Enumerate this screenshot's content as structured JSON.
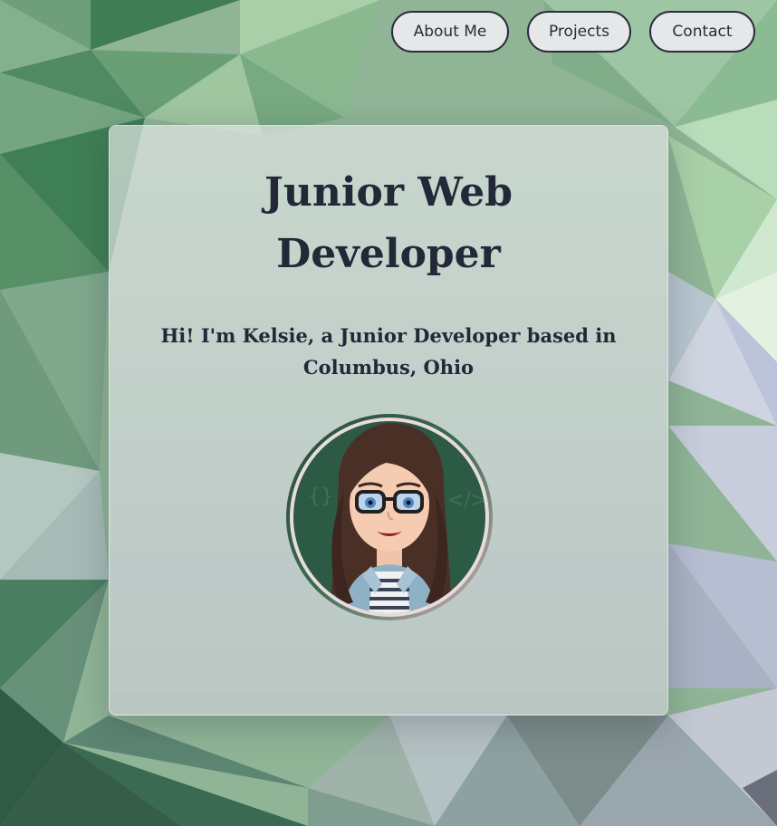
{
  "nav": {
    "items": [
      {
        "label": "About Me"
      },
      {
        "label": "Projects"
      },
      {
        "label": "Contact"
      }
    ]
  },
  "hero": {
    "title": "Junior Web Developer",
    "intro": "Hi! I'm Kelsie, a Junior Developer based in Columbus, Ohio"
  },
  "colors": {
    "text": "#232838",
    "button_bg": "#e6e7e8",
    "button_border": "#2a2d3a",
    "avatar_bg": "#2d5a45"
  },
  "icons": {
    "avatar": "cartoon-avatar-icon"
  }
}
